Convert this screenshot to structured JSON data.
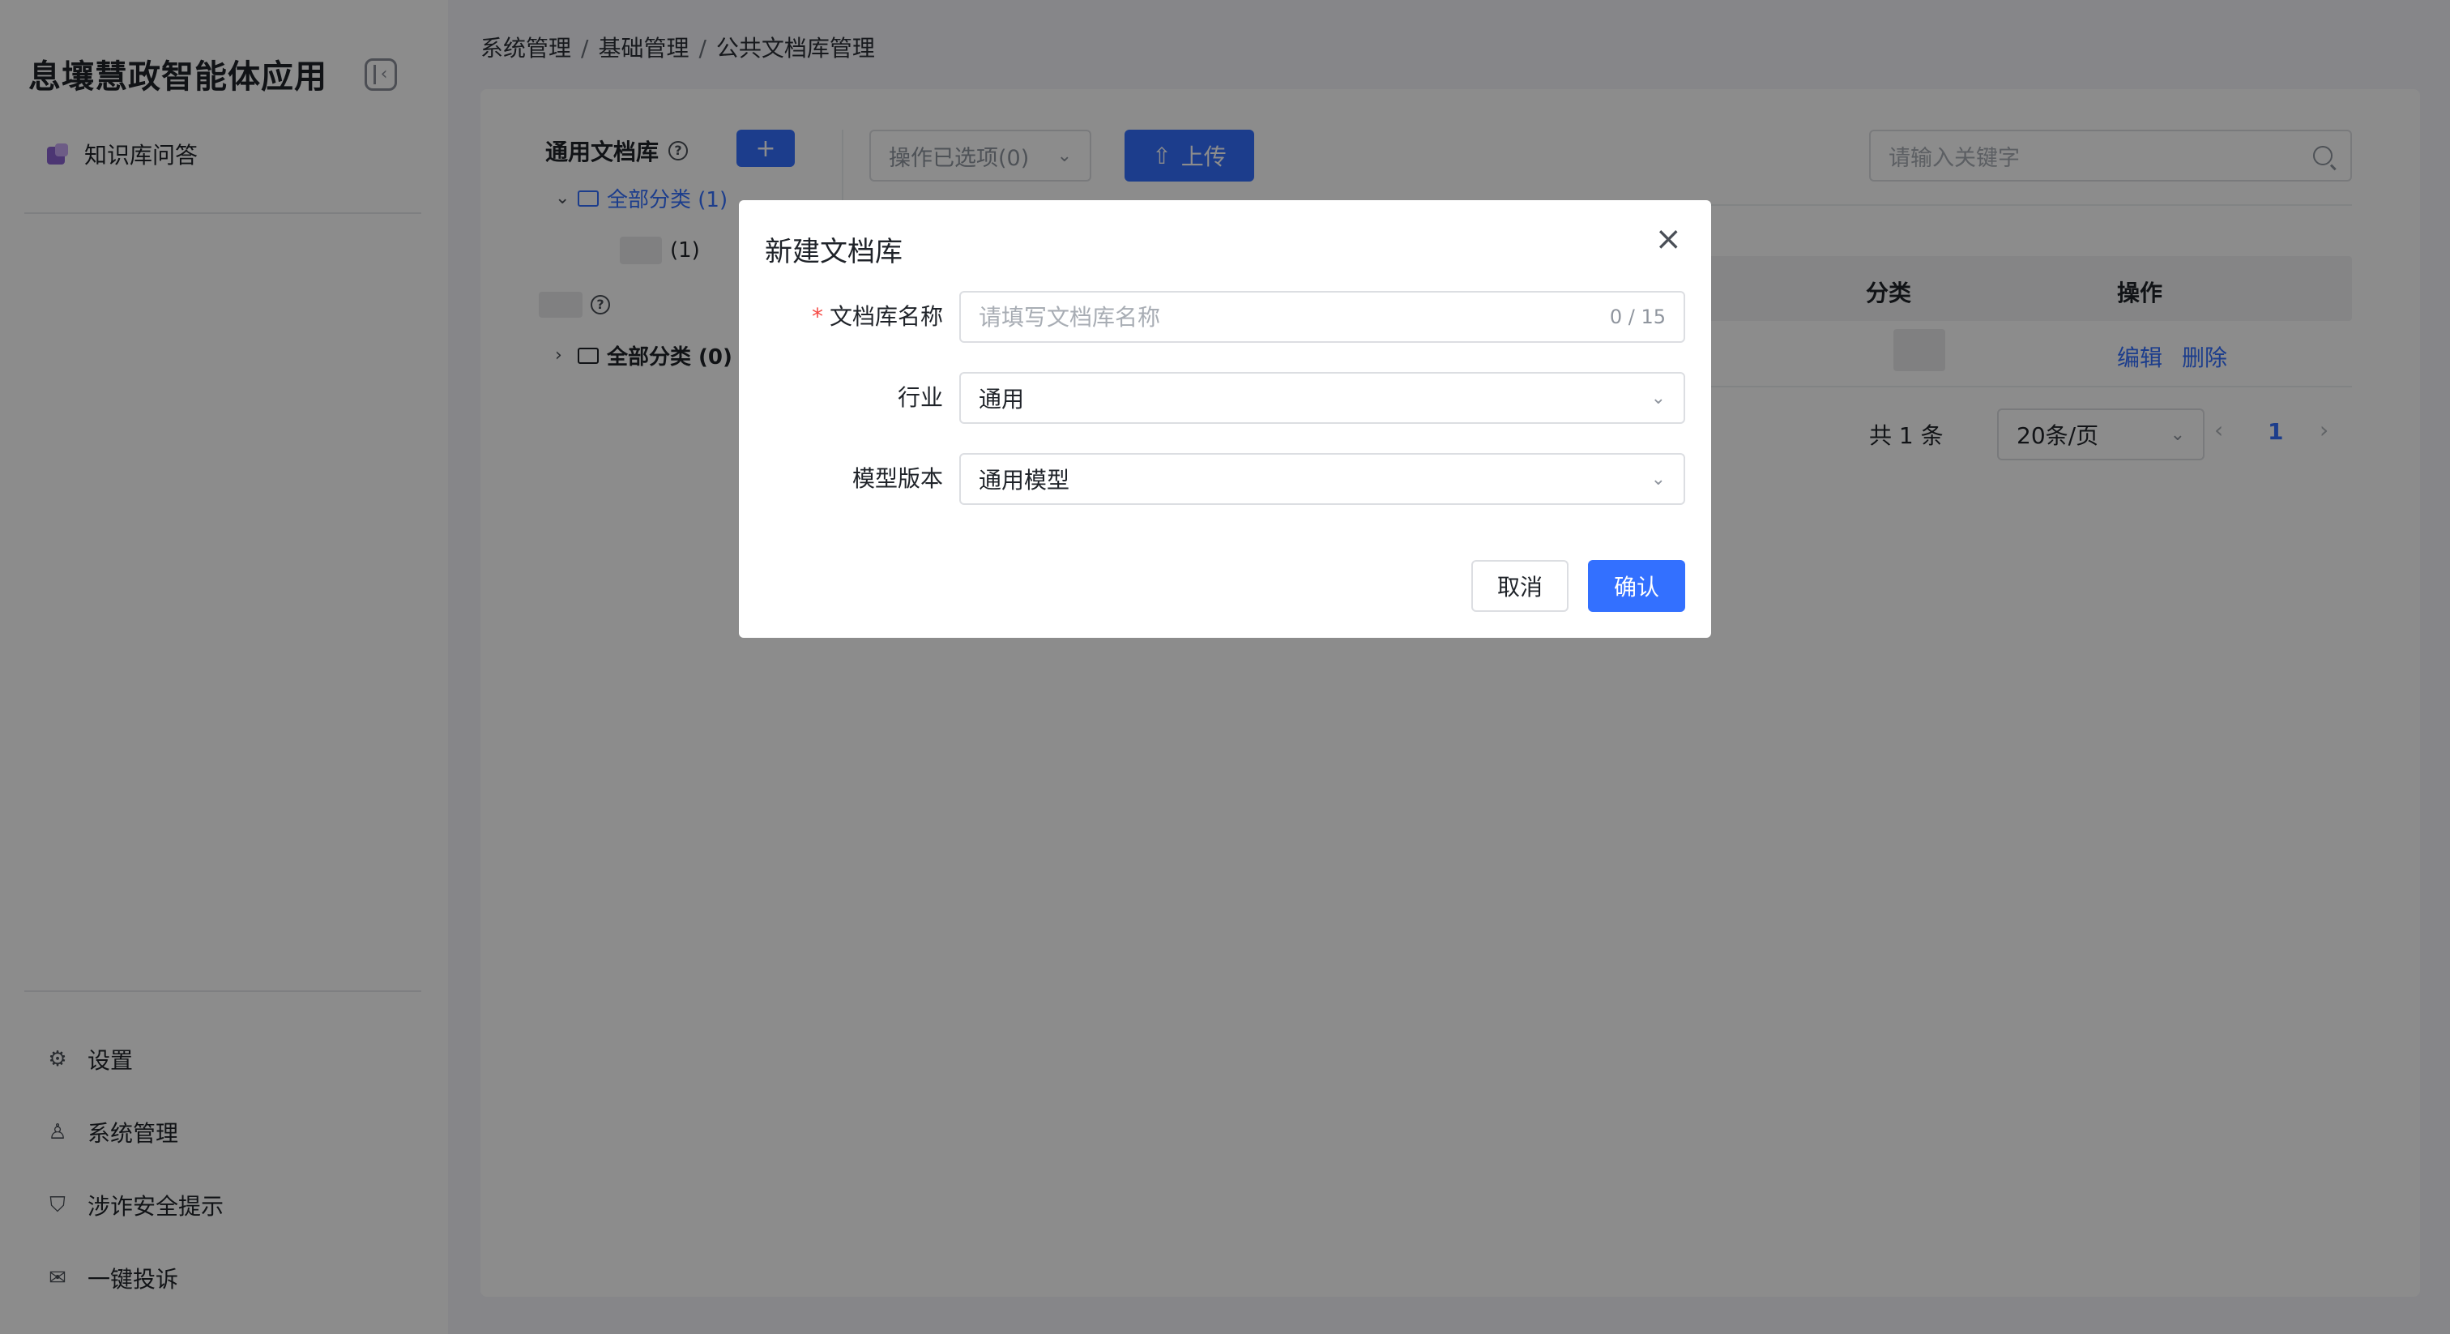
{
  "app": {
    "title": "息壤慧政智能体应用"
  },
  "sidebar": {
    "top_item": {
      "label": "知识库问答",
      "icon": "knowledge-base-icon"
    },
    "bottom_items": [
      {
        "label": "设置",
        "icon": "settings-icon"
      },
      {
        "label": "系统管理",
        "icon": "user-admin-icon"
      },
      {
        "label": "涉诈安全提示",
        "icon": "shield-icon"
      },
      {
        "label": "一键投诉",
        "icon": "complaint-icon"
      }
    ]
  },
  "breadcrumb": [
    "系统管理",
    "基础管理",
    "公共文档库管理"
  ],
  "tree": {
    "header": "通用文档库",
    "add_label": "+",
    "group1_root": "全部分类 (1)",
    "group1_child_count": "(1)",
    "group2_root": "全部分类 (0)"
  },
  "toolbar": {
    "ops_placeholder": "操作已选项(0)",
    "upload_label": "上传",
    "search_placeholder": "请输入关键字"
  },
  "table": {
    "columns": {
      "category": "分类",
      "actions": "操作"
    },
    "row_actions": {
      "edit": "编辑",
      "delete": "删除"
    }
  },
  "pagination": {
    "total": "共 1 条",
    "page_size": "20条/页",
    "current": "1"
  },
  "modal": {
    "title": "新建文档库",
    "name_label": "文档库名称",
    "name_placeholder": "请填写文档库名称",
    "name_counter": "0 / 15",
    "industry_label": "行业",
    "industry_value": "通用",
    "model_label": "模型版本",
    "model_value": "通用模型",
    "cancel": "取消",
    "confirm": "确认"
  },
  "colors": {
    "primary": "#3370ff",
    "required": "#f54a45",
    "overlay": "rgba(0,0,0,0.45)"
  }
}
